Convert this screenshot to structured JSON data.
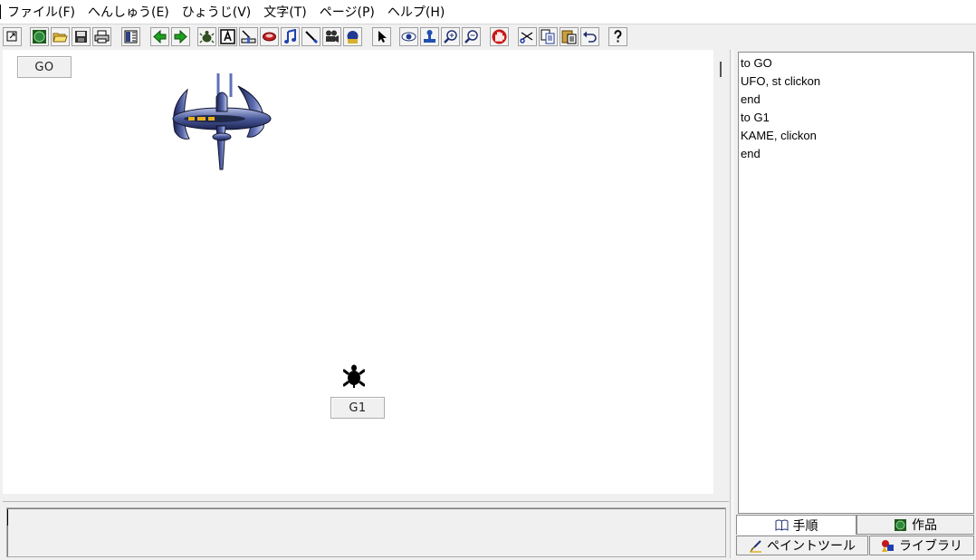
{
  "menu": {
    "items": [
      {
        "label": "ファイル(F)"
      },
      {
        "label": "へんしゅう(E)"
      },
      {
        "label": "ひょうじ(V)"
      },
      {
        "label": "文字(T)"
      },
      {
        "label": "ページ(P)"
      },
      {
        "label": "ヘルプ(H)"
      }
    ]
  },
  "toolbar": {
    "buttons": [
      {
        "icon": "window-arrow-icon"
      },
      {
        "icon": "globe-icon"
      },
      {
        "icon": "open-folder-icon"
      },
      {
        "icon": "save-icon"
      },
      {
        "icon": "print-icon"
      },
      {
        "icon": "page-layout-icon"
      },
      {
        "icon": "back-arrow-icon"
      },
      {
        "icon": "forward-arrow-icon"
      },
      {
        "icon": "turtle-new-icon"
      },
      {
        "icon": "text-box-icon"
      },
      {
        "icon": "slider-icon"
      },
      {
        "icon": "button-tool-icon"
      },
      {
        "icon": "music-icon"
      },
      {
        "icon": "pen-icon"
      },
      {
        "icon": "video-icon"
      },
      {
        "icon": "media-icon"
      },
      {
        "icon": "select-arrow-icon"
      },
      {
        "icon": "eye-icon"
      },
      {
        "icon": "stamp-icon"
      },
      {
        "icon": "zoom-in-icon"
      },
      {
        "icon": "zoom-out-icon"
      },
      {
        "icon": "stop-hand-icon"
      },
      {
        "icon": "cut-icon"
      },
      {
        "icon": "copy-icon"
      },
      {
        "icon": "paste-icon"
      },
      {
        "icon": "undo-icon"
      },
      {
        "icon": "help-icon"
      }
    ]
  },
  "stage": {
    "go_button": "GO",
    "g1_button": "G1",
    "sprites": [
      "ufo",
      "turtle"
    ]
  },
  "script": {
    "lines": [
      "to GO",
      "UFO, st clickon",
      "end",
      "to G1",
      "KAME, clickon",
      "end"
    ]
  },
  "command_line": {
    "value": ""
  },
  "tabs": {
    "procedures": "手順",
    "works": "作品",
    "paint_tools": "ペイントツール",
    "library": "ライブラリ"
  },
  "colors": {
    "window_bg": "#f0f0f0",
    "stage_bg": "#ffffff",
    "ufo_body": "#4a5a9a"
  }
}
